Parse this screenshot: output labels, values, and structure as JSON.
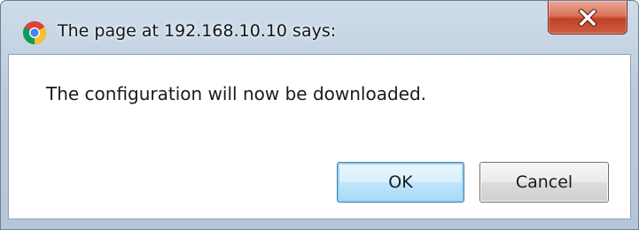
{
  "dialog": {
    "title": "The page at 192.168.10.10 says:",
    "message": "The configuration will now be downloaded.",
    "buttons": {
      "ok_label": "OK",
      "cancel_label": "Cancel"
    },
    "icons": {
      "app_icon": "chrome-icon",
      "close_icon": "close-icon"
    },
    "colors": {
      "close_button": "#c94a33",
      "default_button_border": "#3c7fb1"
    }
  }
}
